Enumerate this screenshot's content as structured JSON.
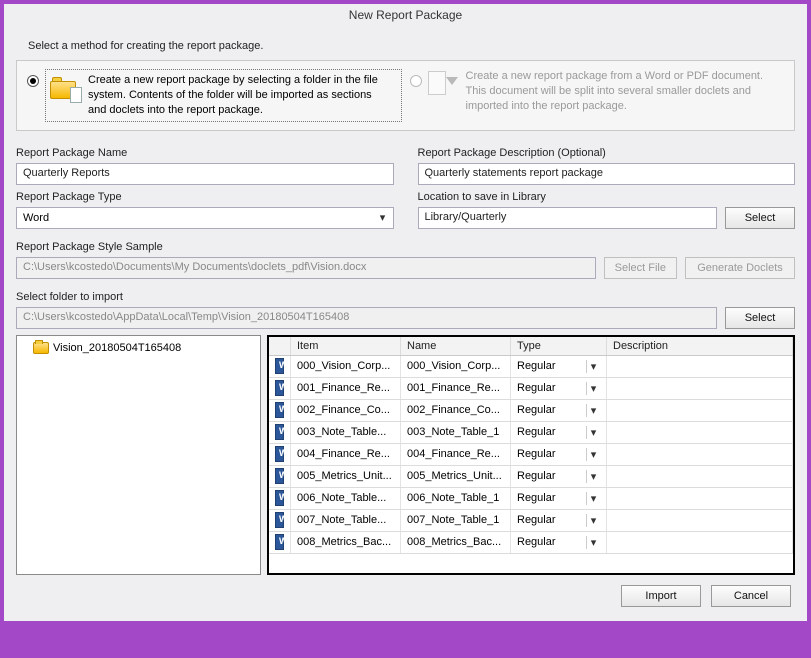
{
  "window": {
    "title": "New Report Package"
  },
  "intro": "Select a method for creating the report package.",
  "methods": {
    "folder": "Create a new report package by selecting a folder in the file system. Contents of the folder will be imported as sections and doclets into the report package.",
    "document": "Create a new report package from a Word or PDF document. This document will be split into several smaller doclets and imported into the report package."
  },
  "labels": {
    "name": "Report Package Name",
    "desc": "Report Package Description (Optional)",
    "type": "Report Package Type",
    "location": "Location to save in Library",
    "style": "Report Package Style Sample",
    "folder": "Select folder to import"
  },
  "fields": {
    "name": "Quarterly Reports",
    "desc": "Quarterly statements report package",
    "type": "Word",
    "location": "Library/Quarterly",
    "style": "C:\\Users\\kcostedo\\Documents\\My Documents\\doclets_pdf\\Vision.docx",
    "folder": "C:\\Users\\kcostedo\\AppData\\Local\\Temp\\Vision_20180504T165408"
  },
  "buttons": {
    "select": "Select",
    "selectFile": "Select File",
    "generate": "Generate Doclets",
    "import": "Import",
    "cancel": "Cancel"
  },
  "tree": {
    "root": "Vision_20180504T165408"
  },
  "grid": {
    "headers": {
      "item": "Item",
      "name": "Name",
      "type": "Type",
      "desc": "Description"
    },
    "rows": [
      {
        "item": "000_Vision_Corp...",
        "name": "000_Vision_Corp...",
        "type": "Regular",
        "desc": ""
      },
      {
        "item": "001_Finance_Re...",
        "name": "001_Finance_Re...",
        "type": "Regular",
        "desc": ""
      },
      {
        "item": "002_Finance_Co...",
        "name": "002_Finance_Co...",
        "type": "Regular",
        "desc": ""
      },
      {
        "item": "003_Note_Table...",
        "name": "003_Note_Table_1",
        "type": "Regular",
        "desc": ""
      },
      {
        "item": "004_Finance_Re...",
        "name": "004_Finance_Re...",
        "type": "Regular",
        "desc": ""
      },
      {
        "item": "005_Metrics_Unit...",
        "name": "005_Metrics_Unit...",
        "type": "Regular",
        "desc": ""
      },
      {
        "item": "006_Note_Table...",
        "name": "006_Note_Table_1",
        "type": "Regular",
        "desc": ""
      },
      {
        "item": "007_Note_Table...",
        "name": "007_Note_Table_1",
        "type": "Regular",
        "desc": ""
      },
      {
        "item": "008_Metrics_Bac...",
        "name": "008_Metrics_Bac...",
        "type": "Regular",
        "desc": ""
      }
    ]
  }
}
